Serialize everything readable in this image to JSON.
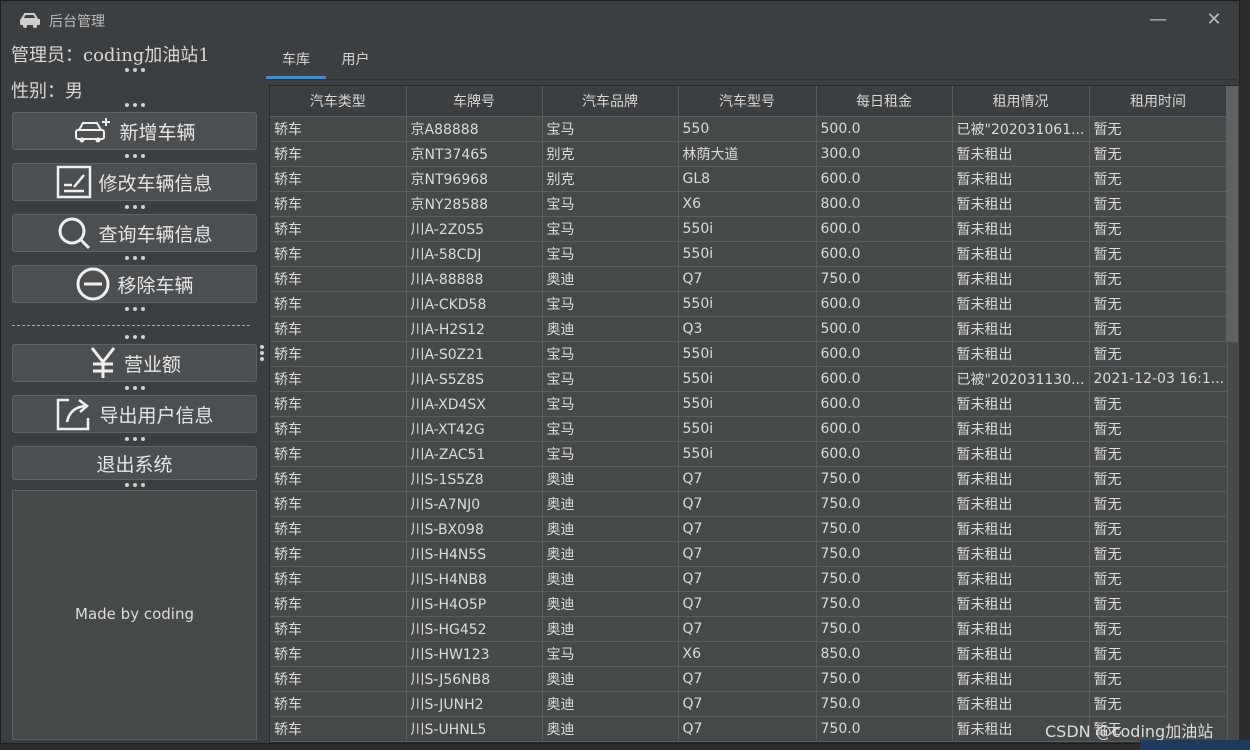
{
  "window": {
    "title": "后台管理"
  },
  "user": {
    "admin": "管理员：coding加油站1",
    "gender": "性别：男"
  },
  "buttons": {
    "add": "新增车辆",
    "edit": "修改车辆信息",
    "query": "查询车辆信息",
    "remove": "移除车辆",
    "revenue": "营业额",
    "export": "导出用户信息",
    "exit": "退出系统"
  },
  "panel": {
    "text": "Made by coding"
  },
  "tabs": [
    "车库",
    "用户"
  ],
  "table": {
    "headers": [
      "汽车类型",
      "车牌号",
      "汽车品牌",
      "汽车型号",
      "每日租金",
      "租用情况",
      "租用时间"
    ],
    "rows": [
      [
        "轿车",
        "京A88888",
        "宝马",
        "550",
        "500.0",
        "已被\"202031061...",
        "暂无"
      ],
      [
        "轿车",
        "京NT37465",
        "别克",
        "林荫大道",
        "300.0",
        "暂未租出",
        "暂无"
      ],
      [
        "轿车",
        "京NT96968",
        "别克",
        "GL8",
        "600.0",
        "暂未租出",
        "暂无"
      ],
      [
        "轿车",
        "京NY28588",
        "宝马",
        "X6",
        "800.0",
        "暂未租出",
        "暂无"
      ],
      [
        "轿车",
        "川A-2Z0S5",
        "宝马",
        "550i",
        "600.0",
        "暂未租出",
        "暂无"
      ],
      [
        "轿车",
        "川A-58CDJ",
        "宝马",
        "550i",
        "600.0",
        "暂未租出",
        "暂无"
      ],
      [
        "轿车",
        "川A-88888",
        "奥迪",
        "Q7",
        "750.0",
        "暂未租出",
        "暂无"
      ],
      [
        "轿车",
        "川A-CKD58",
        "宝马",
        "550i",
        "600.0",
        "暂未租出",
        "暂无"
      ],
      [
        "轿车",
        "川A-H2S12",
        "奥迪",
        "Q3",
        "500.0",
        "暂未租出",
        "暂无"
      ],
      [
        "轿车",
        "川A-S0Z21",
        "宝马",
        "550i",
        "600.0",
        "暂未租出",
        "暂无"
      ],
      [
        "轿车",
        "川A-S5Z8S",
        "宝马",
        "550i",
        "600.0",
        "已被\"202031130...",
        "2021-12-03 16:1..."
      ],
      [
        "轿车",
        "川A-XD4SX",
        "宝马",
        "550i",
        "600.0",
        "暂未租出",
        "暂无"
      ],
      [
        "轿车",
        "川A-XT42G",
        "宝马",
        "550i",
        "600.0",
        "暂未租出",
        "暂无"
      ],
      [
        "轿车",
        "川A-ZAC51",
        "宝马",
        "550i",
        "600.0",
        "暂未租出",
        "暂无"
      ],
      [
        "轿车",
        "川S-1S5Z8",
        "奥迪",
        "Q7",
        "750.0",
        "暂未租出",
        "暂无"
      ],
      [
        "轿车",
        "川S-A7NJ0",
        "奥迪",
        "Q7",
        "750.0",
        "暂未租出",
        "暂无"
      ],
      [
        "轿车",
        "川S-BX098",
        "奥迪",
        "Q7",
        "750.0",
        "暂未租出",
        "暂无"
      ],
      [
        "轿车",
        "川S-H4N5S",
        "奥迪",
        "Q7",
        "750.0",
        "暂未租出",
        "暂无"
      ],
      [
        "轿车",
        "川S-H4NB8",
        "奥迪",
        "Q7",
        "750.0",
        "暂未租出",
        "暂无"
      ],
      [
        "轿车",
        "川S-H4O5P",
        "奥迪",
        "Q7",
        "750.0",
        "暂未租出",
        "暂无"
      ],
      [
        "轿车",
        "川S-HG452",
        "奥迪",
        "Q7",
        "750.0",
        "暂未租出",
        "暂无"
      ],
      [
        "轿车",
        "川S-HW123",
        "宝马",
        "X6",
        "850.0",
        "暂未租出",
        "暂无"
      ],
      [
        "轿车",
        "川S-J56NB8",
        "奥迪",
        "Q7",
        "750.0",
        "暂未租出",
        "暂无"
      ],
      [
        "轿车",
        "川S-JUNH2",
        "奥迪",
        "Q7",
        "750.0",
        "暂未租出",
        "暂无"
      ],
      [
        "轿车",
        "川S-UHNL5",
        "奥迪",
        "Q7",
        "750.0",
        "暂未租出",
        "暂无"
      ]
    ]
  },
  "watermark": "CSDN @coding加油站"
}
